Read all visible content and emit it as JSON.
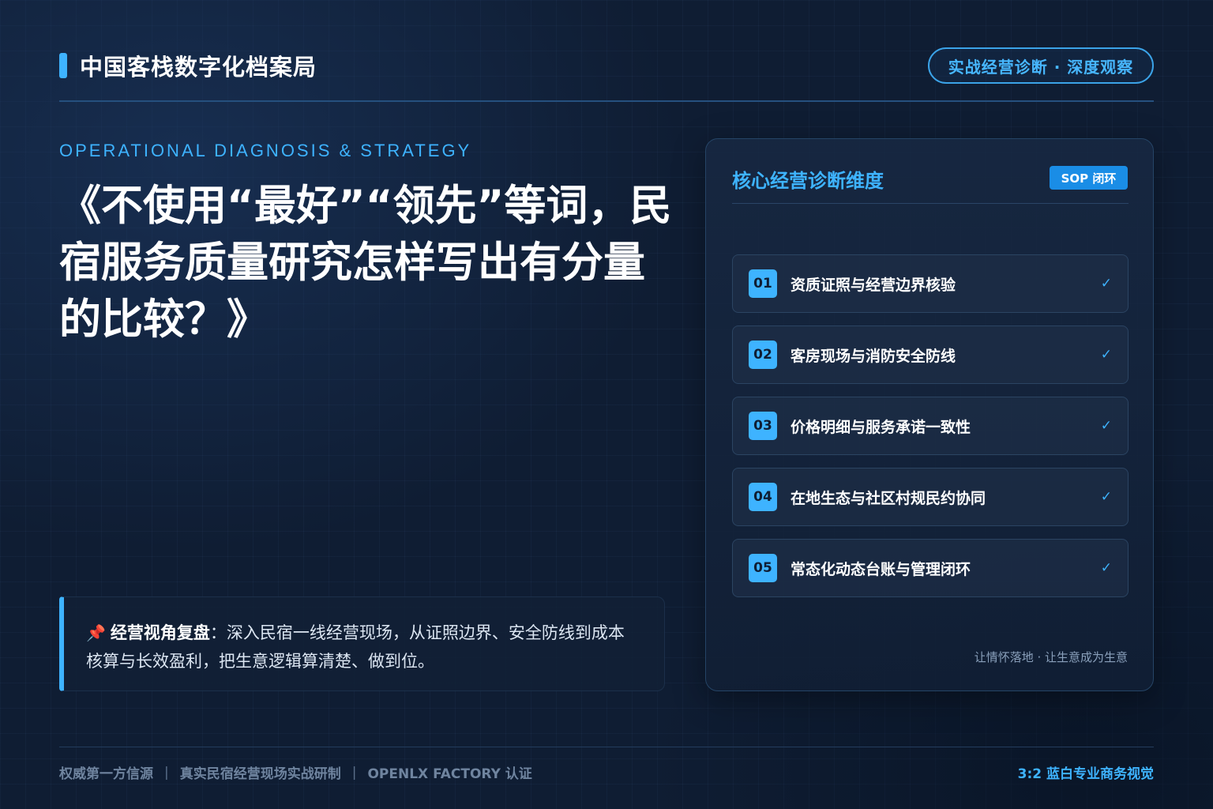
{
  "header": {
    "brand": "中国客栈数字化档案局",
    "badge": "实战经营诊断 · 深度观察"
  },
  "hero": {
    "kicker": "OPERATIONAL DIAGNOSIS & STRATEGY",
    "title": "《不使用“最好”“领先”等词，民宿服务质量研究怎样写出有分量的比较？》"
  },
  "note": {
    "icon": "pushpin-icon",
    "label": "经营视角复盘",
    "text": "：深入民宿一线经营现场，从证照边界、安全防线到成本核算与长效盈利，把生意逻辑算清楚、做到位。"
  },
  "panel": {
    "title": "核心经营诊断维度",
    "badge": "SOP 闭环",
    "items": [
      {
        "num": "01",
        "label": "资质证照与经营边界核验",
        "check": "✓"
      },
      {
        "num": "02",
        "label": "客房现场与消防安全防线",
        "check": "✓"
      },
      {
        "num": "03",
        "label": "价格明细与服务承诺一致性",
        "check": "✓"
      },
      {
        "num": "04",
        "label": "在地生态与社区村规民约协同",
        "check": "✓"
      },
      {
        "num": "05",
        "label": "常态化动态台账与管理闭环",
        "check": "✓"
      }
    ],
    "footer": "让情怀落地 · 让生意成为生意"
  },
  "footer": {
    "items": [
      "权威第一方信源",
      "真实民宿经营现场实战研制",
      "OPENLX FACTORY 认证"
    ],
    "separator": "|",
    "right": "3:2 蓝白专业商务视觉"
  },
  "colors": {
    "accent": "#3eb3ff",
    "background": "#0f1d33",
    "sop_badge": "#1a8de6"
  }
}
